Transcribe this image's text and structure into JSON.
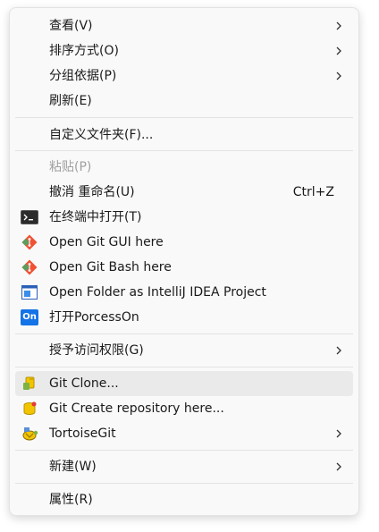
{
  "menu": {
    "items": {
      "view": {
        "label": "查看(V)"
      },
      "sort": {
        "label": "排序方式(O)"
      },
      "group": {
        "label": "分组依据(P)"
      },
      "refresh": {
        "label": "刷新(E)"
      },
      "customize": {
        "label": "自定义文件夹(F)..."
      },
      "paste": {
        "label": "粘贴(P)"
      },
      "undo": {
        "label": "撤消 重命名(U)",
        "shortcut": "Ctrl+Z"
      },
      "terminal": {
        "label": "在终端中打开(T)",
        "icon": "terminal-icon"
      },
      "git_gui": {
        "label": "Open Git GUI here",
        "icon": "git-icon"
      },
      "git_bash": {
        "label": "Open Git Bash here",
        "icon": "git-icon"
      },
      "intellij": {
        "label": "Open Folder as IntelliJ IDEA Project",
        "icon": "intellij-icon"
      },
      "processon": {
        "label": "打开PorcessOn",
        "icon_text": "On",
        "icon": "processon-icon"
      },
      "access": {
        "label": "授予访问权限(G)"
      },
      "git_clone": {
        "label": "Git Clone...",
        "icon": "git-clone-icon"
      },
      "git_create": {
        "label": "Git Create repository here...",
        "icon": "git-create-repo-icon"
      },
      "tortoise": {
        "label": "TortoiseGit",
        "icon": "tortoisegit-icon"
      },
      "new": {
        "label": "新建(W)"
      },
      "properties": {
        "label": "属性(R)"
      }
    }
  },
  "colors": {
    "git": "#f05133",
    "git_alt": "#4aa564",
    "processon": "#1473e6",
    "tortoise_yellow": "#f2c400"
  }
}
